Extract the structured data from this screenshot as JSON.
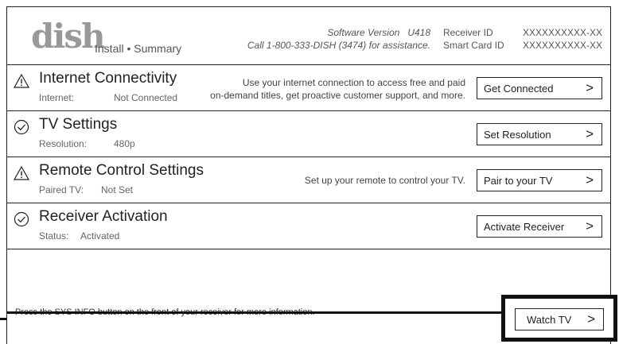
{
  "header": {
    "logo": "dish",
    "subtitle": "Install • Summary",
    "software_version_label": "Software Version",
    "software_version": "U418",
    "assistance": "Call 1-800-333-DISH (3474) for assistance.",
    "receiver_id_label": "Receiver ID",
    "receiver_id": "XXXXXXXXXX-XX",
    "smart_card_label": "Smart Card ID",
    "smart_card_id": "XXXXXXXXXX-XX"
  },
  "rows": [
    {
      "icon": "warning-icon",
      "title": "Internet Connectivity",
      "label": "Internet:",
      "value": "Not Connected",
      "desc_line1": "Use your internet connection to access free and paid",
      "desc_line2": "on-demand titles, get proactive customer support, and more.",
      "button": "Get Connected"
    },
    {
      "icon": "check-circle-icon",
      "title": "TV Settings",
      "label": "Resolution:",
      "value": "480p",
      "desc_line1": "",
      "desc_line2": "",
      "button": "Set Resolution"
    },
    {
      "icon": "warning-icon",
      "title": "Remote Control Settings",
      "label": "Paired TV:",
      "value": "Not Set",
      "desc_line1": "Set up your remote to control your TV.",
      "desc_line2": "",
      "button": "Pair to your TV"
    },
    {
      "icon": "check-circle-icon",
      "title": "Receiver Activation",
      "label": "Status:",
      "value": "Activated",
      "desc_line1": "",
      "desc_line2": "",
      "button": "Activate Receiver"
    }
  ],
  "footer": {
    "info": "Press the SYS INFO button on the front of your receiver for more information.",
    "watch_button": "Watch TV"
  },
  "chevron": ">"
}
